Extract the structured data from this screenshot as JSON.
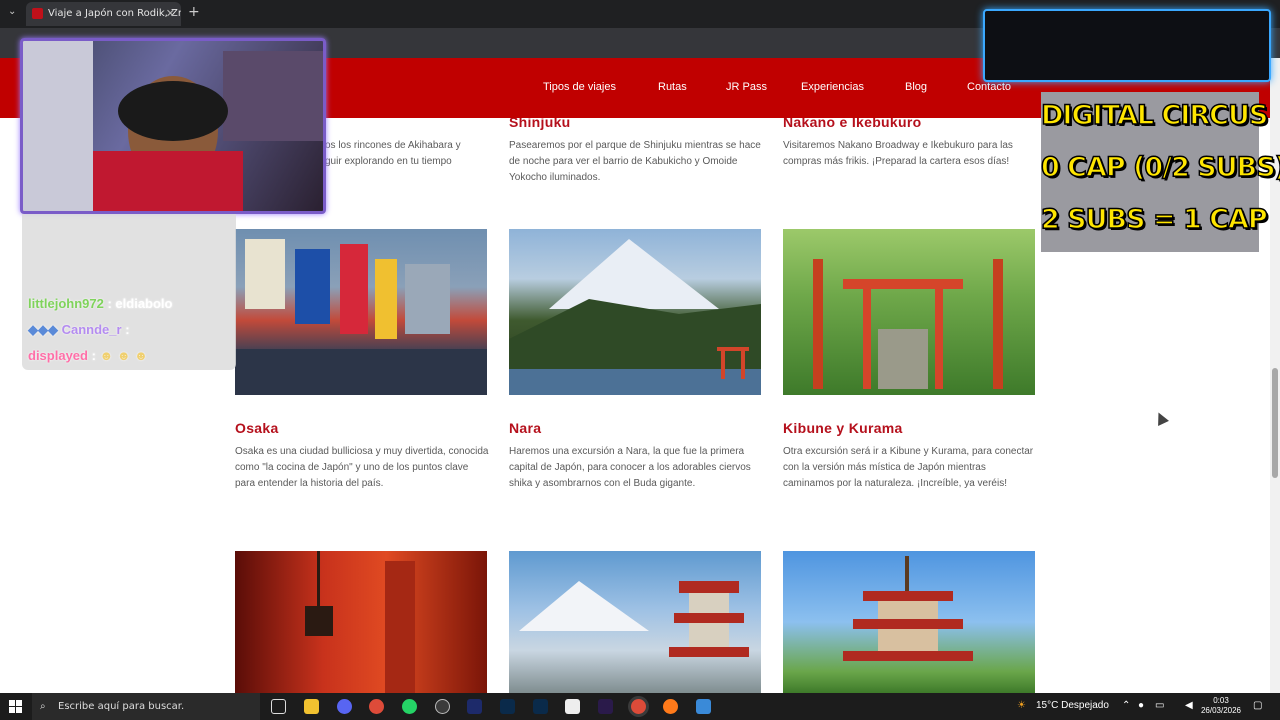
{
  "browser": {
    "tab_title": "Viaje a Japón con Rodik, Zroly y",
    "tab_close": "✕",
    "new_tab": "+"
  },
  "site_nav": {
    "items": [
      "Tipos de viajes",
      "Rutas",
      "JR Pass",
      "Experiencias",
      "Blog",
      "Contacto"
    ]
  },
  "cards_row1": [
    {
      "title": "",
      "desc": "os los rincones de Akihabara y\nguir explorando en tu tiempo"
    },
    {
      "title": "Shinjuku",
      "desc": "Pasearemos por el parque de Shinjuku mientras se hace de noche para ver el barrio de Kabukicho y Omoide Yokocho iluminados."
    },
    {
      "title": "Nakano e Ikebukuro",
      "desc": "Visitaremos Nakano Broadway e Ikebukuro para las compras más frikis. ¡Preparad la cartera esos días!"
    }
  ],
  "cards_row2": [
    {
      "title": "Osaka",
      "desc": "Osaka es una ciudad bulliciosa y muy divertida, conocida como \"la cocina de Japón\" y uno de los puntos clave para entender la historia del país."
    },
    {
      "title": "Nara",
      "desc": "Haremos una excursión a Nara, la que fue la primera capital de Japón, para conocer a los adorables ciervos shika y asombrarnos con el Buda gigante."
    },
    {
      "title": "Kibune y Kurama",
      "desc": "Otra excursión será ir a Kibune y Kurama, para conectar con la versión más mística de Japón mientras caminamos por la naturaleza. ¡Increíble, ya veréis!"
    }
  ],
  "overlay": {
    "chat": [
      {
        "user": "littlejohn972",
        "sep": " : ",
        "msg": "eldiabolo",
        "user_color": "#7fd35b"
      },
      {
        "user": "Cannde_r",
        "sep": " : ",
        "msg": "",
        "user_color": "#b48cf0"
      },
      {
        "user": "displayed",
        "sep": " : ",
        "msg": "",
        "user_color": "#ff6fa8"
      }
    ],
    "goal_lines": [
      "DIGITAL CIRCUS",
      "0 CAP (0/2 SUBS)",
      "2 SUBS = 1 CAP"
    ]
  },
  "taskbar": {
    "search_placeholder": "Escribe aquí para buscar.",
    "weather": "15°C  Despejado",
    "time": "0:03",
    "date": "26/03/2026"
  },
  "colors": {
    "brand_red": "#c00000",
    "title_red": "#b5101c",
    "goal_yellow": "#ffe600"
  },
  "icons": {
    "windows": "windows-icon",
    "search": "search-icon",
    "task_view": "task-view-icon"
  }
}
